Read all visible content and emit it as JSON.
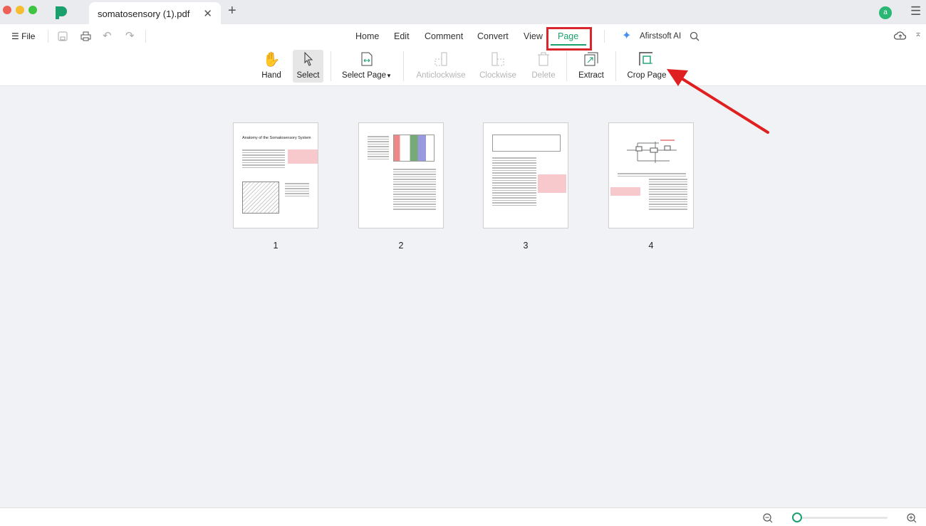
{
  "window": {
    "tab_title": "somatosensory (1).pdf",
    "avatar_letter": "a"
  },
  "menu": {
    "file_label": "File"
  },
  "nav_tabs": [
    {
      "label": "Home"
    },
    {
      "label": "Edit"
    },
    {
      "label": "Comment"
    },
    {
      "label": "Convert"
    },
    {
      "label": "View"
    },
    {
      "label": "Page",
      "active": true
    }
  ],
  "ai_label": "Afirstsoft AI",
  "tools": {
    "hand": "Hand",
    "select": "Select",
    "select_page": "Select Page",
    "anticlockwise": "Anticlockwise",
    "clockwise": "Clockwise",
    "delete": "Delete",
    "extract": "Extract",
    "crop_page": "Crop Page"
  },
  "pages": [
    {
      "number": "1",
      "title": "Anatomy of the Somatosensory System"
    },
    {
      "number": "2"
    },
    {
      "number": "3"
    },
    {
      "number": "4"
    }
  ],
  "colors": {
    "accent": "#1aa06d",
    "annotation": "#e02020",
    "highlight": "#f7c8cc"
  },
  "zoom": {
    "level_fraction": 0
  }
}
